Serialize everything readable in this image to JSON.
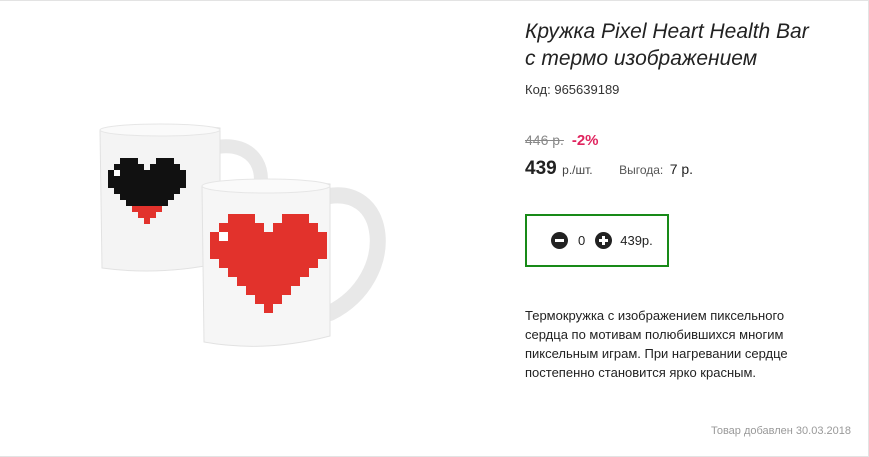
{
  "product": {
    "title_line1": "Кружка Pixel Heart Health Bar",
    "title_line2": "с термо изображением",
    "code_label": "Код:",
    "code_value": "965639189",
    "image_icon": "pixel-heart-mugs-image"
  },
  "pricing": {
    "old_price": "446 р.",
    "discount": "-2%",
    "price": "439",
    "price_unit": "р./шт.",
    "benefit_label": "Выгода:",
    "benefit_value": "7 р."
  },
  "cart": {
    "minus_icon": "minus-circle-icon",
    "quantity": "0",
    "plus_icon": "plus-circle-icon",
    "total": "439р.",
    "border_color": "#188a18"
  },
  "description": "Термокружка с изображением пиксельного сердца по мотивам полюбившихся многим пиксельным играм. При нагревании сердце постепенно становится ярко красным.",
  "added_date": "Товар добавлен 30.03.2018",
  "colors": {
    "discount": "#e0245e",
    "heart_red": "#e2322c",
    "heart_black": "#111111"
  }
}
